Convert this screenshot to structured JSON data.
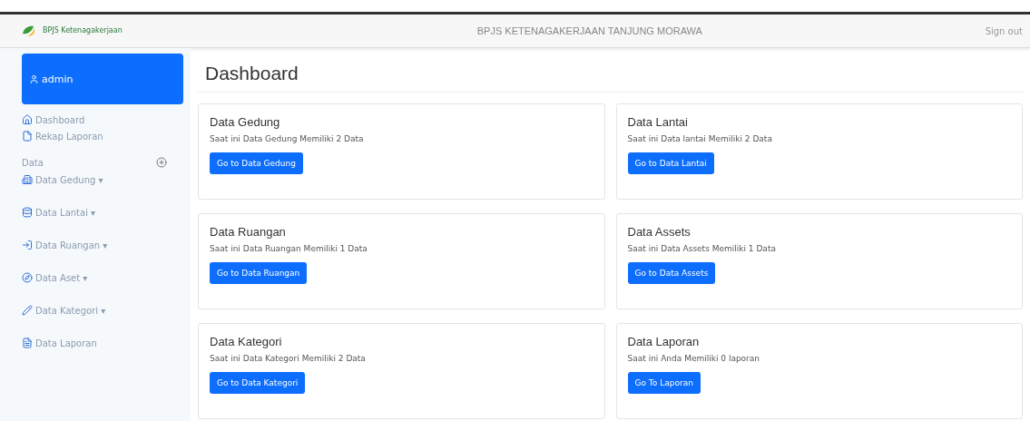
{
  "header": {
    "logo_text": "BPJS Ketenagakerjaan",
    "title": "BPJS KETENAGAKERJAAN TANJUNG MORAWA",
    "sign_out": "Sign out"
  },
  "sidebar": {
    "user": "admin",
    "items": [
      {
        "label": "Dashboard",
        "kind": "home"
      },
      {
        "label": "Rekap Laporan",
        "kind": "file"
      }
    ],
    "section": "Data",
    "data_items": [
      {
        "label": "Data Gedung",
        "kind": "building",
        "caret": "▾"
      },
      {
        "label": "Data Lantai",
        "kind": "database",
        "caret": "▾"
      },
      {
        "label": "Data Ruangan",
        "kind": "enter",
        "caret": "▾"
      },
      {
        "label": "Data Aset",
        "kind": "compass",
        "caret": "▾"
      },
      {
        "label": "Data Kategori",
        "kind": "pen",
        "caret": "▾"
      },
      {
        "label": "Data Laporan",
        "kind": "filefill"
      }
    ]
  },
  "page_title": "Dashboard",
  "cards": [
    {
      "title": "Data Gedung",
      "text": "Saat ini Data Gedung Memiliki 2 Data",
      "button": "Go to Data Gedung"
    },
    {
      "title": "Data Lantai",
      "text": "Saat ini Data lantai Memiliki 2 Data",
      "button": "Go to Data Lantai"
    },
    {
      "title": "Data Ruangan",
      "text": "Saat ini Data Ruangan Memiliki 1 Data",
      "button": "Go to Data Ruangan"
    },
    {
      "title": "Data Assets",
      "text": "Saat ini Data Assets Memiliki 1 Data",
      "button": "Go to Data Assets"
    },
    {
      "title": "Data Kategori",
      "text": "Saat ini Data Kategori Memiliki 2 Data",
      "button": "Go to Data Kategori"
    },
    {
      "title": "Data Laporan",
      "text": "Saat ini Anda Memiliki 0 laporan",
      "button": "Go To Laporan"
    }
  ]
}
